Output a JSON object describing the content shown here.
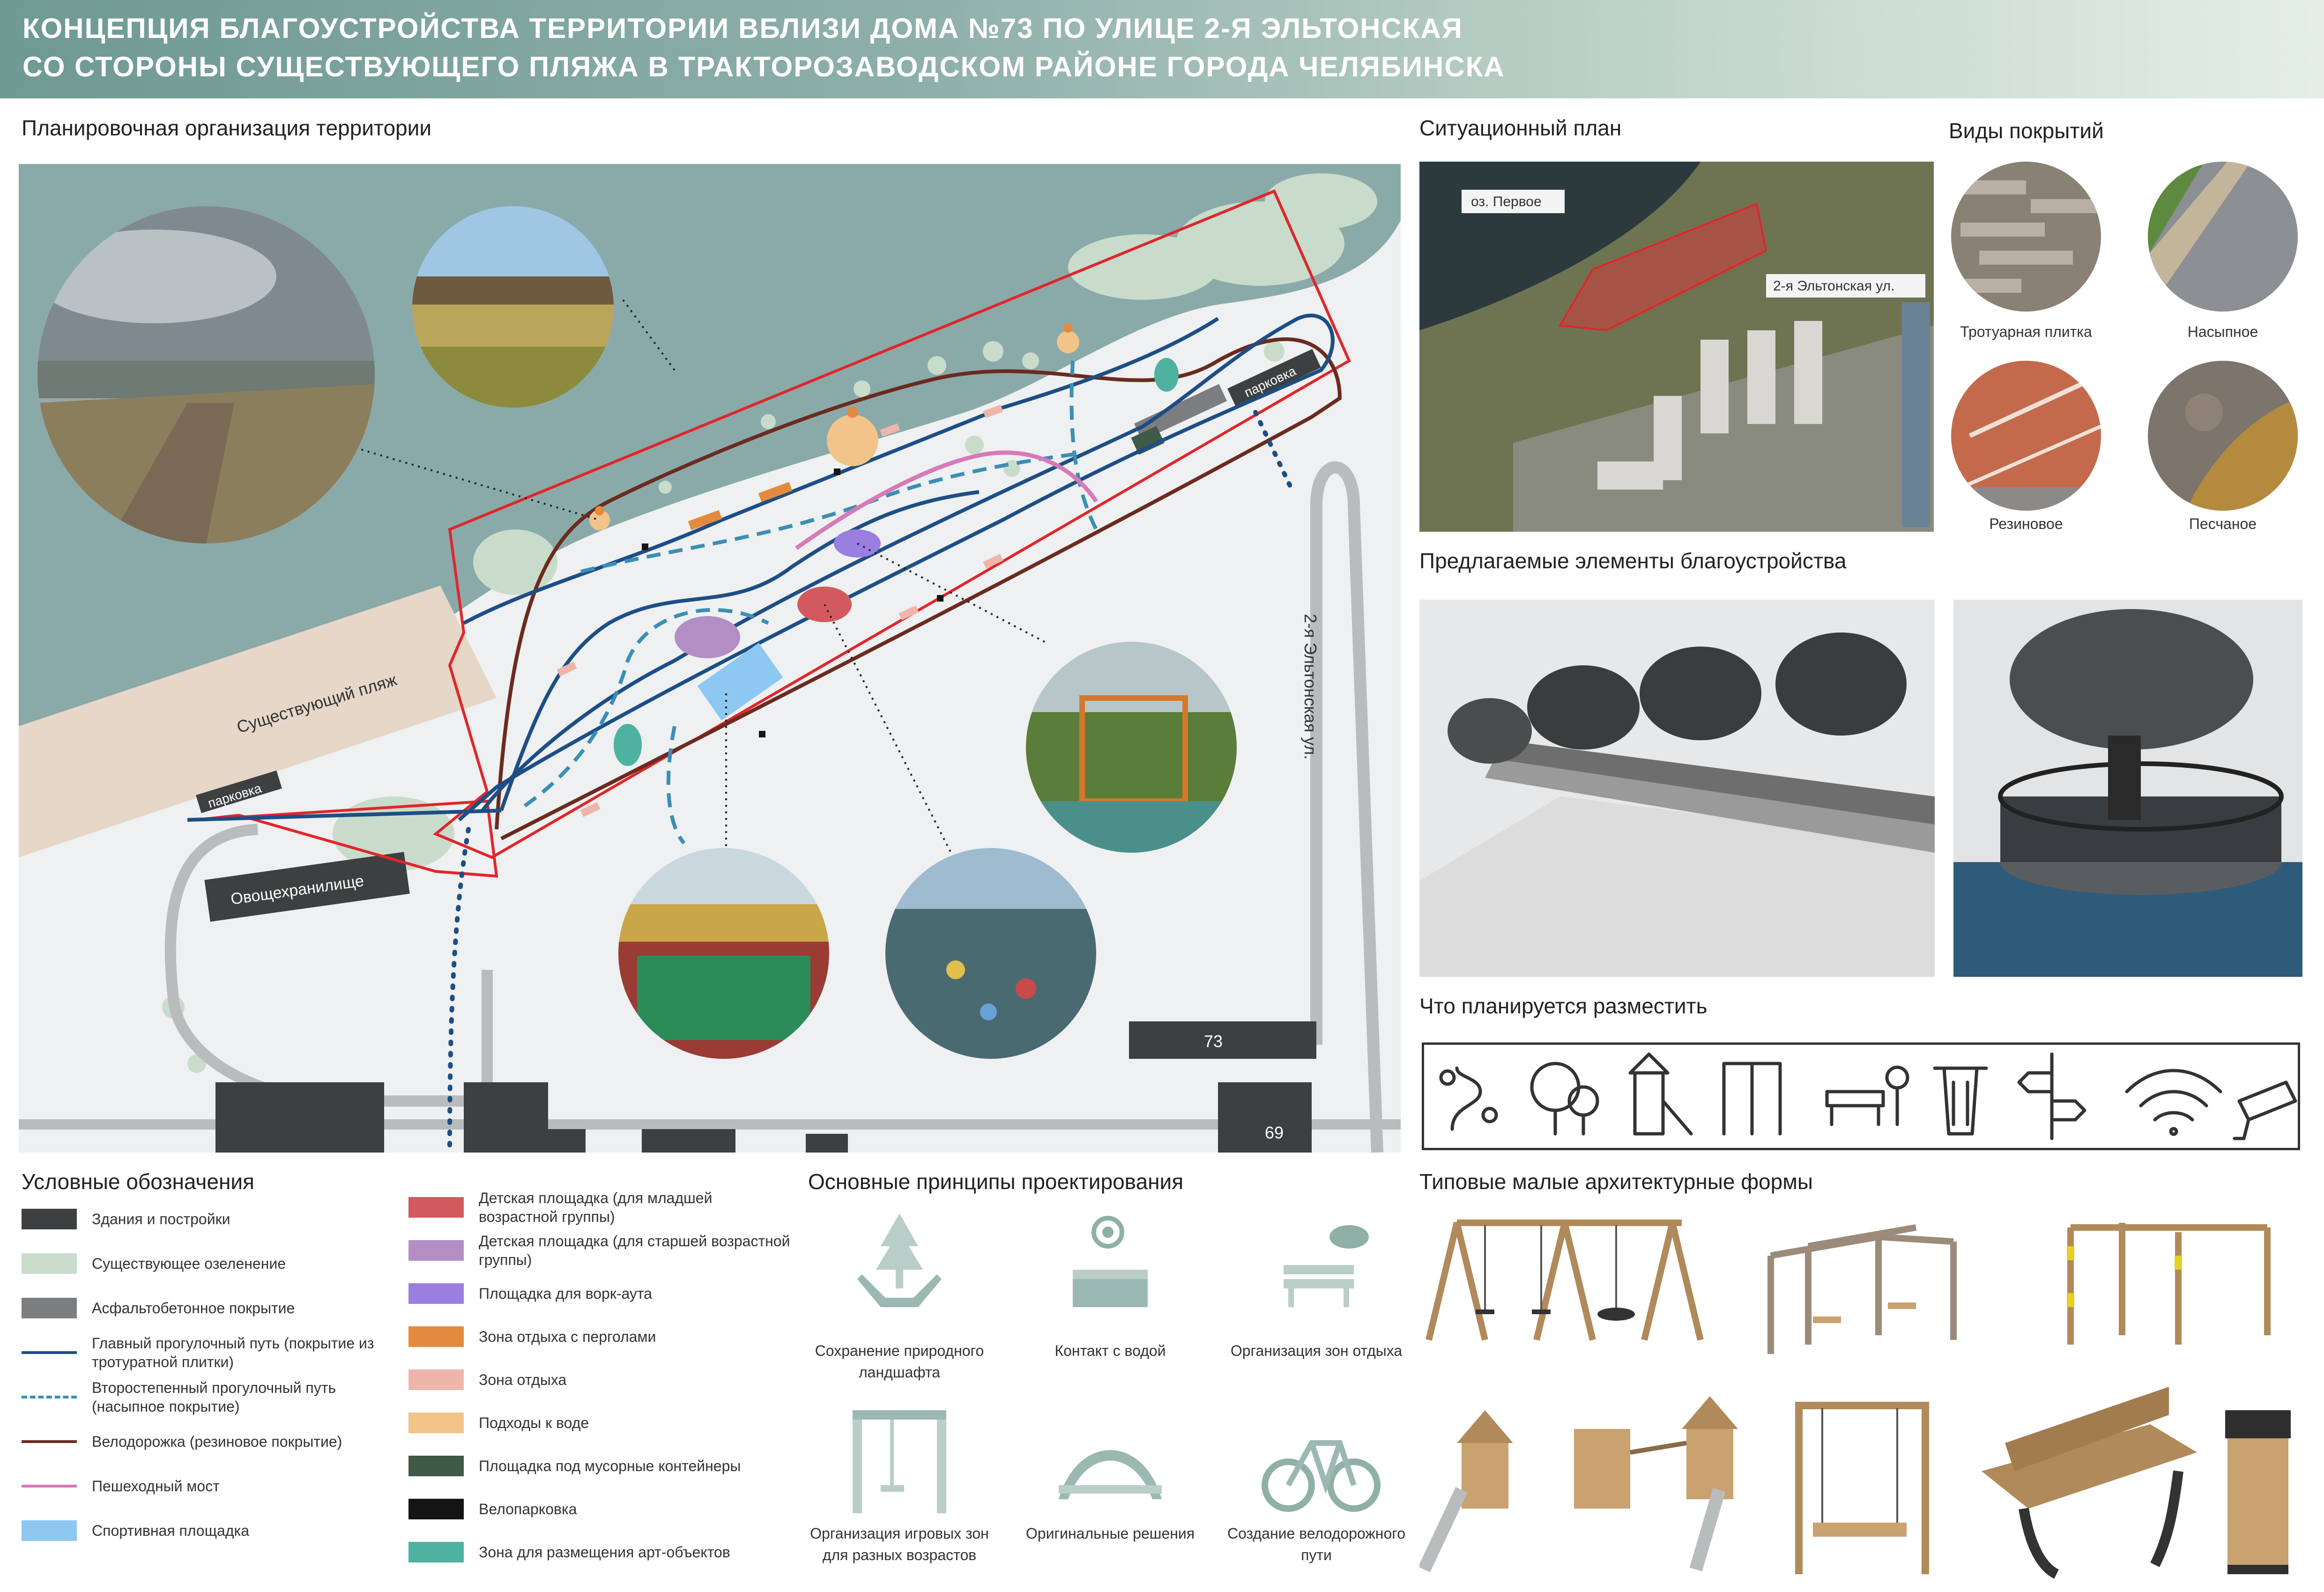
{
  "header": {
    "line1": "КОНЦЕПЦИЯ БЛАГОУСТРОЙСТВА ТЕРРИТОРИИ ВБЛИЗИ ДОМА №73 ПО УЛИЦЕ 2-Я ЭЛЬТОНСКАЯ",
    "line2": "СО СТОРОНЫ СУЩЕСТВУЮЩЕГО ПЛЯЖА В ТРАКТОРОЗАВОДСКОМ РАЙОНЕ ГОРОДА ЧЕЛЯБИНСКА"
  },
  "plan": {
    "title": "Планировочная организация территории",
    "beach": "Существующий пляж",
    "parking1": "парковка",
    "parking2": "парковка",
    "storage": "Овощехранилище",
    "street": "2-я Эльтонская ул.",
    "house73": "73",
    "house69": "69"
  },
  "situation": {
    "title": "Ситуационный план",
    "lake": "оз. Первое",
    "street": "2-я Эльтонская ул."
  },
  "coverings": {
    "title": "Виды покрытий",
    "items": [
      "Тротуарная плитка",
      "Насыпное",
      "Резиновое",
      "Песчаное"
    ]
  },
  "proposed": {
    "title": "Предлагаемые элементы благоустройства"
  },
  "planned": {
    "title": "Что планируется разместить",
    "icons": [
      "walking-path-icon",
      "trees-icon",
      "playground-icon",
      "workout-icon",
      "bench-icon",
      "trash-bin-icon",
      "signpost-icon",
      "wifi-icon",
      "cctv-camera-icon"
    ]
  },
  "legend": {
    "title": "Условные обозначения",
    "left": [
      {
        "label": "Здания и постройки",
        "color": "#3d3f40",
        "kind": "fill"
      },
      {
        "label": "Существующее озеленение",
        "color": "#c9dccb",
        "kind": "fill"
      },
      {
        "label": "Асфальтобетонное покрытие",
        "color": "#7b7d7e",
        "kind": "fill"
      },
      {
        "label": "Главный прогулочный путь (покрытие из тротуратной плитки)",
        "color": "#1d4e86",
        "kind": "line"
      },
      {
        "label": "Второстепенный прогулочный путь (насыпное покрытие)",
        "color": "#3a8fb5",
        "kind": "dash"
      },
      {
        "label": "Велодорожка (резиновое покрытие)",
        "color": "#6b2b1e",
        "kind": "line"
      },
      {
        "label": "Пешеходный мост",
        "color": "#d879b8",
        "kind": "line"
      },
      {
        "label": "Спортивная площадка",
        "color": "#8cc8f2",
        "kind": "fill"
      }
    ],
    "right": [
      {
        "label": "Детская площадка (для младшей возрастной группы)",
        "color": "#d25a5e",
        "kind": "fill"
      },
      {
        "label": "Детская площадка (для старшей возрастной группы)",
        "color": "#b28ec4",
        "kind": "fill"
      },
      {
        "label": "Площадка для ворк-аута",
        "color": "#9a7fe0",
        "kind": "fill"
      },
      {
        "label": "Зона отдыха с перголами",
        "color": "#e48a3e",
        "kind": "fill"
      },
      {
        "label": "Зона отдыха",
        "color": "#efb4aa",
        "kind": "fill"
      },
      {
        "label": "Подходы к воде",
        "color": "#f2c48a",
        "kind": "fill"
      },
      {
        "label": "Площадка под мусорные контейнеры",
        "color": "#3f5a45",
        "kind": "fill"
      },
      {
        "label": "Велопарковка",
        "color": "#141414",
        "kind": "fill"
      },
      {
        "label": "Зона для размещения арт-объектов",
        "color": "#4fb2a0",
        "kind": "fill"
      }
    ]
  },
  "principles": {
    "title": "Основные принципы проектирования",
    "items": [
      {
        "label": "Сохранение природного ландшафта",
        "icon": "nature-preservation-icon"
      },
      {
        "label": "Контакт с водой",
        "icon": "water-contact-icon"
      },
      {
        "label": "Организация зон отдыха",
        "icon": "rest-zone-icon"
      },
      {
        "label": "Организация игровых зон для разных возрастов",
        "icon": "swing-icon"
      },
      {
        "label": "Оригинальные решения",
        "icon": "arch-bridge-icon"
      },
      {
        "label": "Создание велодорожного пути",
        "icon": "bicycle-icon"
      }
    ]
  },
  "smallforms": {
    "title": "Типовые малые архитектурные формы"
  }
}
